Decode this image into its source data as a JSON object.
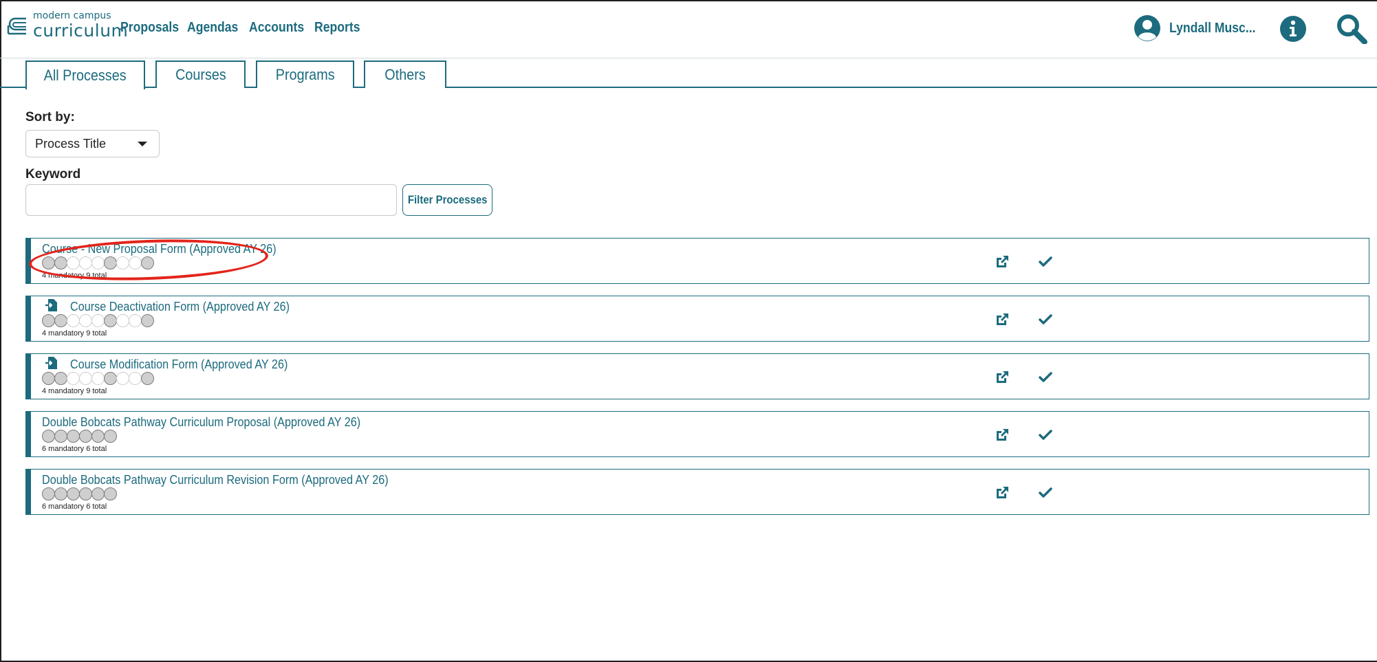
{
  "brand": {
    "small": "modern campus",
    "big": "curriculum"
  },
  "nav": [
    {
      "label": "Proposals"
    },
    {
      "label": "Agendas"
    },
    {
      "label": "Accounts"
    },
    {
      "label": "Reports"
    }
  ],
  "user": {
    "name": "Lyndall Musc..."
  },
  "tabs": [
    {
      "label": "All Processes",
      "active": true
    },
    {
      "label": "Courses",
      "active": false
    },
    {
      "label": "Programs",
      "active": false
    },
    {
      "label": "Others",
      "active": false
    }
  ],
  "sort": {
    "label": "Sort by:",
    "value": "Process Title"
  },
  "keyword": {
    "label": "Keyword",
    "value": "",
    "placeholder": ""
  },
  "filter_button": "Filter Processes",
  "processes": [
    {
      "title": "Course - New Proposal Form (Approved AY 26)",
      "has_icon": false,
      "steps": "MMOOOMOOM",
      "count": "4 mandatory 9 total"
    },
    {
      "title": "Course Deactivation Form (Approved AY 26)",
      "has_icon": true,
      "steps": "MMOOOMOOM",
      "count": "4 mandatory 9 total"
    },
    {
      "title": "Course Modification Form (Approved AY 26)",
      "has_icon": true,
      "steps": "MMOOOMOOM",
      "count": "4 mandatory 9 total"
    },
    {
      "title": "Double Bobcats Pathway Curriculum Proposal (Approved AY 26)",
      "has_icon": false,
      "steps": "MMMMMM",
      "count": "6 mandatory 6 total"
    },
    {
      "title": "Double Bobcats Pathway Curriculum Revision Form (Approved AY 26)",
      "has_icon": false,
      "steps": "MMMMMM",
      "count": "6 mandatory 6 total"
    }
  ],
  "colors": {
    "accent": "#1c6b7e",
    "highlight": "#e3241b"
  },
  "icons": [
    "search-icon",
    "info-icon",
    "user-avatar-icon",
    "edit-external-icon",
    "check-icon",
    "form-import-icon"
  ]
}
